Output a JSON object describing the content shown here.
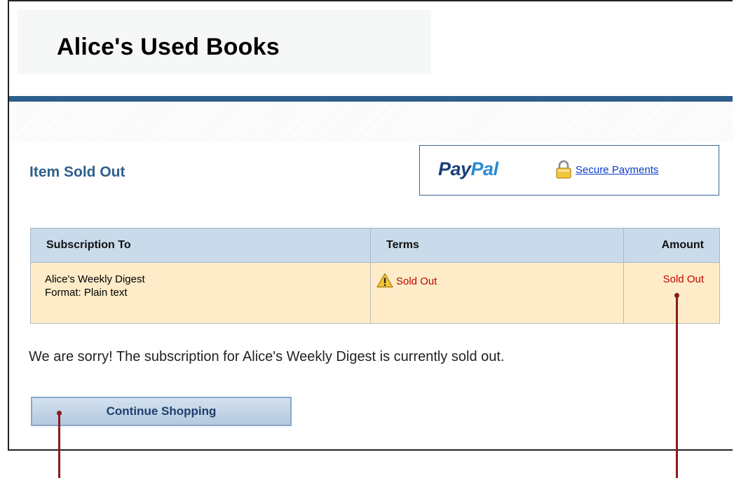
{
  "store": {
    "title": "Alice's Used Books"
  },
  "page": {
    "heading": "Item Sold Out"
  },
  "paypal": {
    "logo_left": "Pay",
    "logo_right": "Pal",
    "secure_link": "Secure Payments"
  },
  "table": {
    "headers": {
      "item": "Subscription To",
      "terms": "Terms",
      "amount": "Amount"
    },
    "rows": [
      {
        "item_name": "Alice's Weekly Digest",
        "item_format": "Format: Plain text",
        "terms": "Sold Out",
        "amount": "Sold Out"
      }
    ]
  },
  "message": "We are sorry! The subscription for Alice's Weekly Digest is currently sold out.",
  "continue_button": "Continue Shopping",
  "colors": {
    "header_rule": "#2e5e8b",
    "heading_blue": "#2f5f8c",
    "table_header_bg": "#c9daea",
    "table_row_bg": "#fdecc7",
    "sold_out_red": "#c40000",
    "callout_red": "#8b1a1a"
  },
  "icons": {
    "lock": "lock-icon",
    "warning": "warning-icon"
  }
}
